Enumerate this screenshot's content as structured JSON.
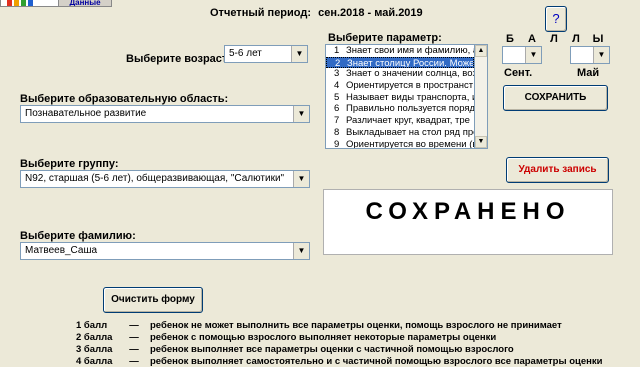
{
  "header": {
    "data_button_label": "Данные",
    "period_label": "Отчетный период:",
    "period_value": "сен.2018 - май.2019"
  },
  "help_button_label": "?",
  "age": {
    "label": "Выберите возраст:",
    "value": "5-6 лет"
  },
  "area": {
    "label": "Выберите образовательную область:",
    "value": "Познавательное развитие"
  },
  "group": {
    "label": "Выберите группу:",
    "value": "N92, старшая (5-6 лет), общеразвивающая, \"Салютики\""
  },
  "surname": {
    "label": "Выберите фамилию:",
    "value": "Матвеев_Саша"
  },
  "parameter": {
    "label": "Выберите параметр:",
    "items": [
      {
        "num": "1",
        "text": "Знает свои имя и фамилию, ад"
      },
      {
        "num": "2",
        "text": "Знает столицу России. Может"
      },
      {
        "num": "3",
        "text": "Знает о значении солнца, воз,"
      },
      {
        "num": "4",
        "text": "Ориентируется в пространст"
      },
      {
        "num": "5",
        "text": "Называет виды транспорта, и"
      },
      {
        "num": "6",
        "text": "Правильно пользуется поряд"
      },
      {
        "num": "7",
        "text": "Различает круг, квадрат, тре"
      },
      {
        "num": "8",
        "text": "Выкладывает на стол ряд пре"
      },
      {
        "num": "9",
        "text": "Ориентируется во времени (в"
      }
    ],
    "selected_index": 1
  },
  "scores": {
    "letters": [
      "Б",
      "А",
      "Л",
      "Л",
      "Ы"
    ],
    "sep_label": "Сент.",
    "may_label": "Май",
    "sep_value": "",
    "may_value": ""
  },
  "save_button_label": "СОХРАНИТЬ",
  "delete_button_label": "Удалить запись",
  "delete_color": "#cc0000",
  "status_text": "СОХРАНЕНО",
  "clear_button_label": "Очистить форму",
  "legend": [
    {
      "score": "1 балл",
      "text": "ребенок не может выполнить все параметры оценки, помощь взрослого не принимает"
    },
    {
      "score": "2 балла",
      "text": "ребенок с помощью взрослого выполняет некоторые параметры оценки"
    },
    {
      "score": "3 балла",
      "text": "ребенок выполняет все параметры оценки с частичной помощью взрослого"
    },
    {
      "score": "4 балла",
      "text": "ребенок выполняет самостоятельно и с частичной помощью взрослого все параметры оценки"
    }
  ],
  "legend_dash": "—",
  "icons": {
    "dropdown": "chevron-down-icon",
    "scroll_up": "arrow-up-icon",
    "scroll_down": "arrow-down-icon"
  }
}
